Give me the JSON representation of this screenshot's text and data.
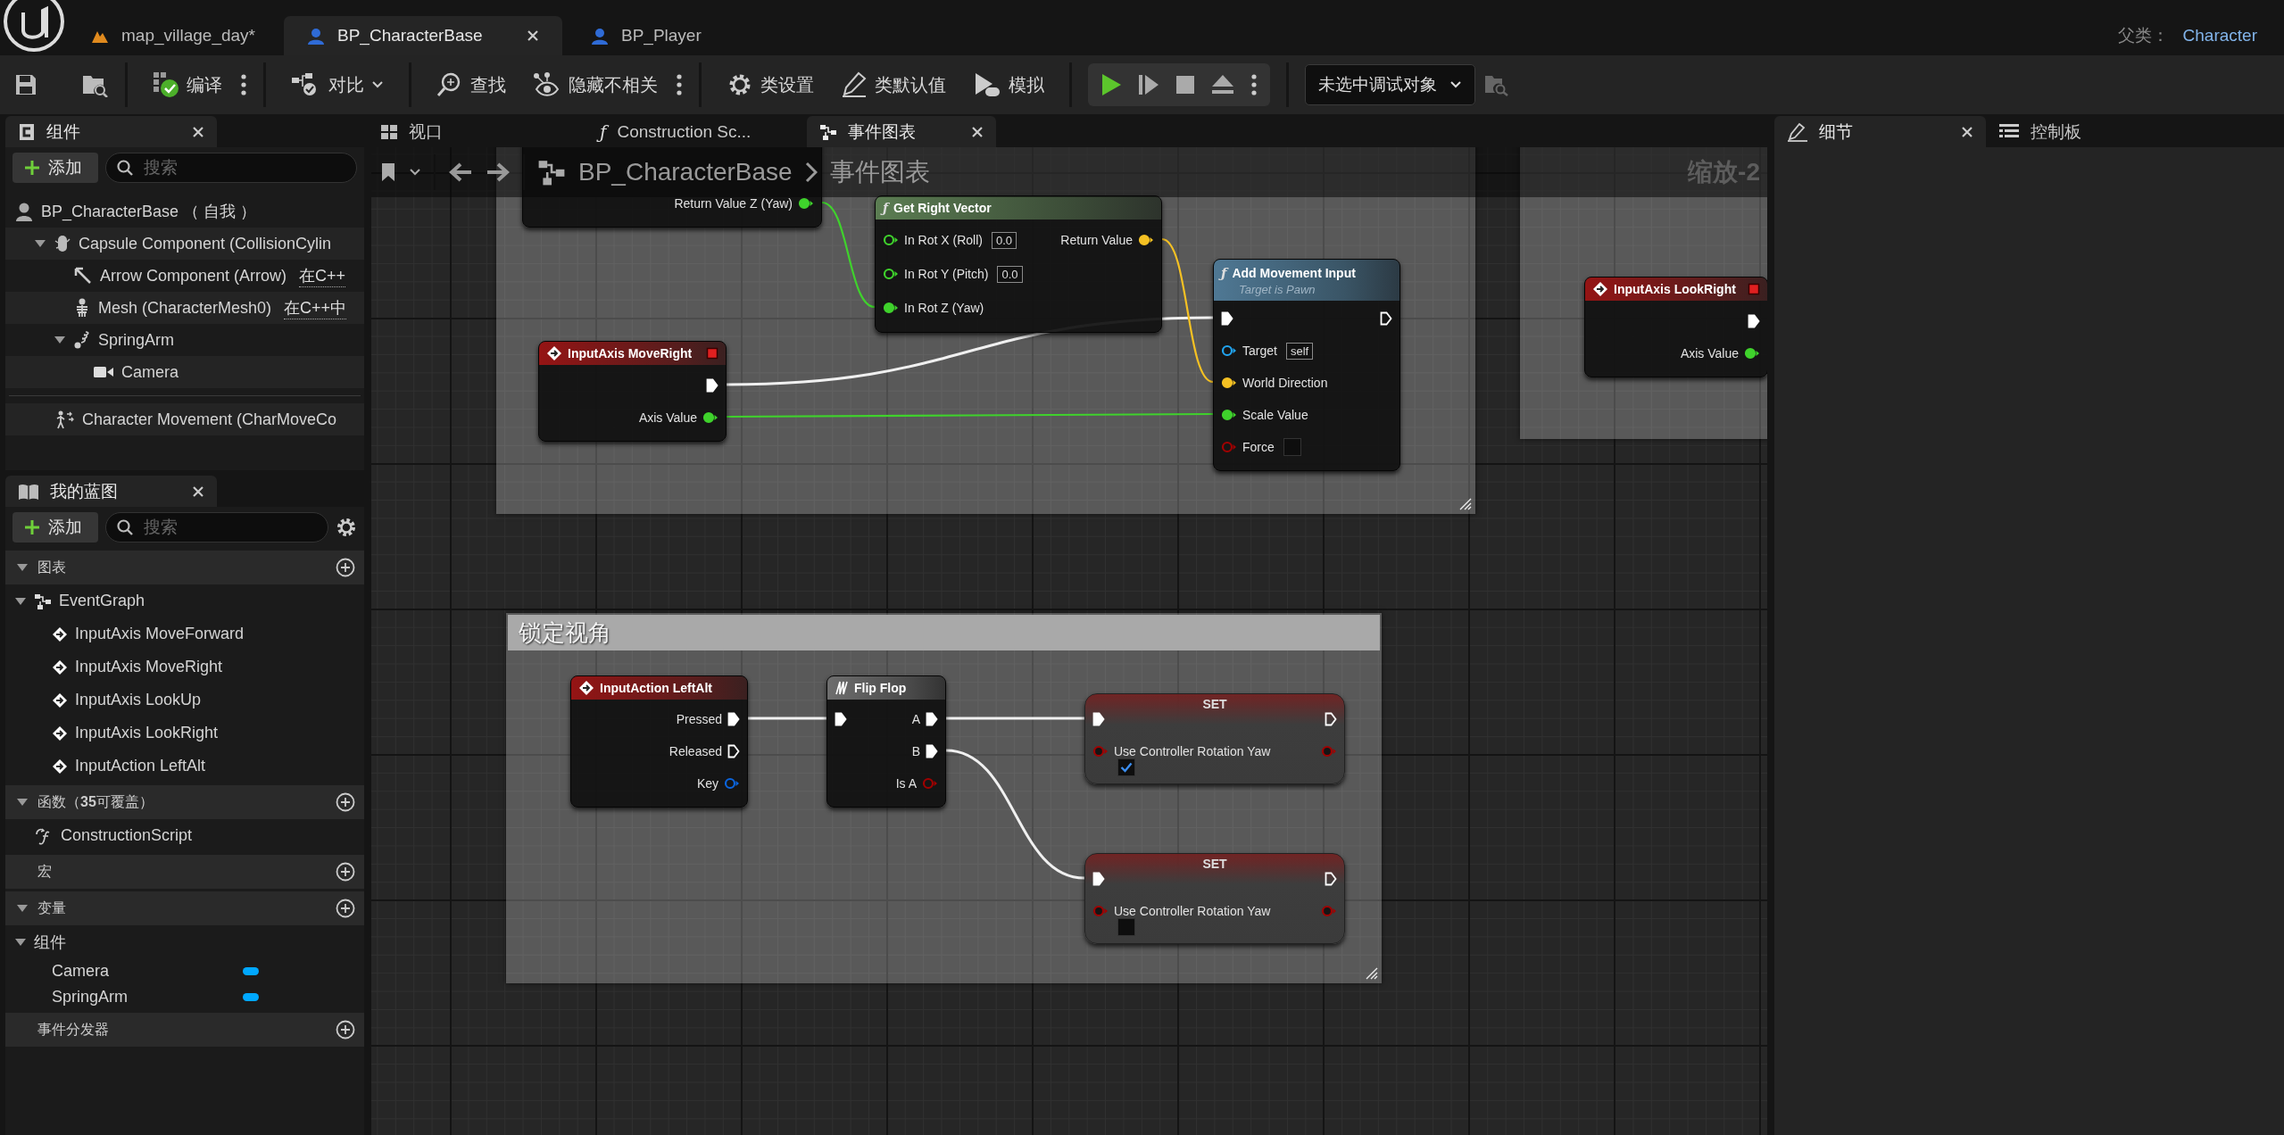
{
  "title_bar": {
    "tabs": [
      {
        "label": "map_village_day*",
        "kind": "level",
        "selected": false
      },
      {
        "label": "BP_CharacterBase",
        "kind": "blueprint",
        "selected": true
      },
      {
        "label": "BP_Player",
        "kind": "blueprint",
        "selected": false
      }
    ],
    "parent_label": "父类：",
    "parent_class": "Character"
  },
  "toolbar": {
    "compile": "编译",
    "diff": "对比",
    "find": "查找",
    "hide_unrelated": "隐藏不相关",
    "class_settings": "类设置",
    "class_defaults": "类默认值",
    "simulate": "模拟",
    "debug_object": "未选中调试对象"
  },
  "components_panel": {
    "tab": "组件",
    "add_button": "添加",
    "search_placeholder": "搜索",
    "tree": [
      {
        "label": "BP_CharacterBase （ 自我 ）",
        "kind": "actor",
        "children": [
          {
            "label": "Capsule Component (CollisionCylin",
            "kind": "capsule",
            "expanded": true,
            "children": [
              {
                "label": "Arrow Component (Arrow)",
                "kind": "arrow",
                "note": "在C++"
              },
              {
                "label": "Mesh (CharacterMesh0)",
                "kind": "mesh",
                "note": "在C++中"
              },
              {
                "label": "SpringArm",
                "kind": "spring",
                "expanded": true,
                "children": [
                  {
                    "label": "Camera",
                    "kind": "camera"
                  }
                ]
              }
            ]
          }
        ]
      }
    ],
    "extra": [
      {
        "label": "Character Movement (CharMoveCo",
        "kind": "movement"
      }
    ]
  },
  "my_blueprint": {
    "tab": "我的蓝图",
    "add_button": "添加",
    "search_placeholder": "搜索",
    "sections": [
      {
        "title": "图表",
        "expanded": true,
        "items": [
          {
            "label": "EventGraph",
            "kind": "graph",
            "expanded": true,
            "children": [
              {
                "label": "InputAxis MoveForward",
                "kind": "event"
              },
              {
                "label": "InputAxis MoveRight",
                "kind": "event"
              },
              {
                "label": "InputAxis LookUp",
                "kind": "event"
              },
              {
                "label": "InputAxis LookRight",
                "kind": "event"
              },
              {
                "label": "InputAction LeftAlt",
                "kind": "event"
              }
            ]
          }
        ]
      },
      {
        "title": "函数（**35**可覆盖）",
        "expanded": true,
        "items": [
          {
            "label": "ConstructionScript",
            "kind": "function"
          }
        ]
      },
      {
        "title": "宏"
      },
      {
        "title": "变量",
        "expanded": true,
        "items": [
          {
            "label": "组件",
            "kind": "category",
            "expanded": true,
            "children": [
              {
                "label": "Camera",
                "kind": "variable"
              },
              {
                "label": "SpringArm",
                "kind": "variable"
              }
            ]
          }
        ]
      },
      {
        "title": "事件分发器"
      }
    ]
  },
  "graph_tabs": [
    {
      "label": "视口",
      "kind": "viewport",
      "selected": false
    },
    {
      "label": "Construction Sc...",
      "kind": "function",
      "icon": "ƒ",
      "selected": false
    },
    {
      "label": "事件图表",
      "kind": "graph",
      "selected": true
    }
  ],
  "details_tabs": [
    {
      "label": "细节",
      "kind": "details",
      "selected": true
    },
    {
      "label": "控制板",
      "kind": "palette",
      "selected": false
    }
  ],
  "graph": {
    "breadcrumb": [
      "BP_CharacterBase",
      "事件图表"
    ],
    "zoom": "缩放-2",
    "comments": [
      {
        "title": "锁定视角"
      }
    ],
    "nodes": [
      {
        "kind": "partial",
        "outputs": [
          {
            "label": "Return Value Z (Yaw)",
            "kind": "float",
            "connected": true
          }
        ]
      },
      {
        "kind": "pure_function",
        "icon": "ƒ",
        "title": "Get Right Vector",
        "inputs": [
          {
            "label": "In Rot X (Roll)",
            "kind": "float",
            "connected": false,
            "value": "0.0"
          },
          {
            "label": "In Rot Y (Pitch)",
            "kind": "float",
            "connected": false,
            "value": "0.0"
          },
          {
            "label": "In Rot Z (Yaw)",
            "kind": "float",
            "connected": true
          }
        ],
        "outputs": [
          {
            "label": "Return Value",
            "kind": "vector",
            "connected": true
          }
        ]
      },
      {
        "kind": "event",
        "title": "InputAxis MoveRight",
        "delegate_pin": true,
        "outputs": [
          {
            "kind": "exec",
            "connected": true
          },
          {
            "label": "Axis Value",
            "kind": "float",
            "connected": true
          }
        ]
      },
      {
        "kind": "function",
        "icon": "ƒ",
        "title": "Add Movement Input",
        "subtitle": "Target is Pawn",
        "inputs": [
          {
            "kind": "exec",
            "connected": true
          },
          {
            "label": "Target",
            "kind": "object",
            "connected": false,
            "value": "self"
          },
          {
            "label": "World Direction",
            "kind": "vector",
            "connected": true
          },
          {
            "label": "Scale Value",
            "kind": "float",
            "connected": true
          },
          {
            "label": "Force",
            "kind": "bool",
            "connected": false,
            "checked": false
          }
        ],
        "outputs": [
          {
            "kind": "exec",
            "connected": false
          }
        ]
      },
      {
        "kind": "event",
        "title": "InputAxis LookRight",
        "delegate_pin": true,
        "outputs": [
          {
            "kind": "exec",
            "connected": true
          },
          {
            "label": "Axis Value",
            "kind": "float",
            "connected": true
          }
        ]
      },
      {
        "kind": "event",
        "title": "InputAction LeftAlt",
        "delegate_pin": false,
        "outputs": [
          {
            "label": "Pressed",
            "kind": "exec",
            "connected": true
          },
          {
            "label": "Released",
            "kind": "exec",
            "connected": false
          },
          {
            "label": "Key",
            "kind": "struct",
            "connected": false
          }
        ]
      },
      {
        "kind": "macro",
        "title": "Flip Flop",
        "inputs": [
          {
            "kind": "exec",
            "connected": true
          }
        ],
        "outputs": [
          {
            "label": "A",
            "kind": "exec",
            "connected": true
          },
          {
            "label": "B",
            "kind": "exec",
            "connected": true
          },
          {
            "label": "Is A",
            "kind": "bool",
            "connected": false
          }
        ]
      },
      {
        "kind": "set",
        "title": "SET",
        "inputs": [
          {
            "kind": "exec",
            "connected": true
          },
          {
            "label": "Use Controller Rotation Yaw",
            "kind": "bool",
            "connected": false,
            "checked": true
          }
        ],
        "outputs": [
          {
            "kind": "exec",
            "connected": false
          },
          {
            "kind": "bool",
            "connected": false
          }
        ]
      },
      {
        "kind": "set",
        "title": "SET",
        "inputs": [
          {
            "kind": "exec",
            "connected": true
          },
          {
            "label": "Use Controller Rotation Yaw",
            "kind": "bool",
            "connected": false,
            "checked": false
          }
        ],
        "outputs": [
          {
            "kind": "exec",
            "connected": false
          },
          {
            "kind": "bool",
            "connected": false
          }
        ]
      }
    ]
  }
}
